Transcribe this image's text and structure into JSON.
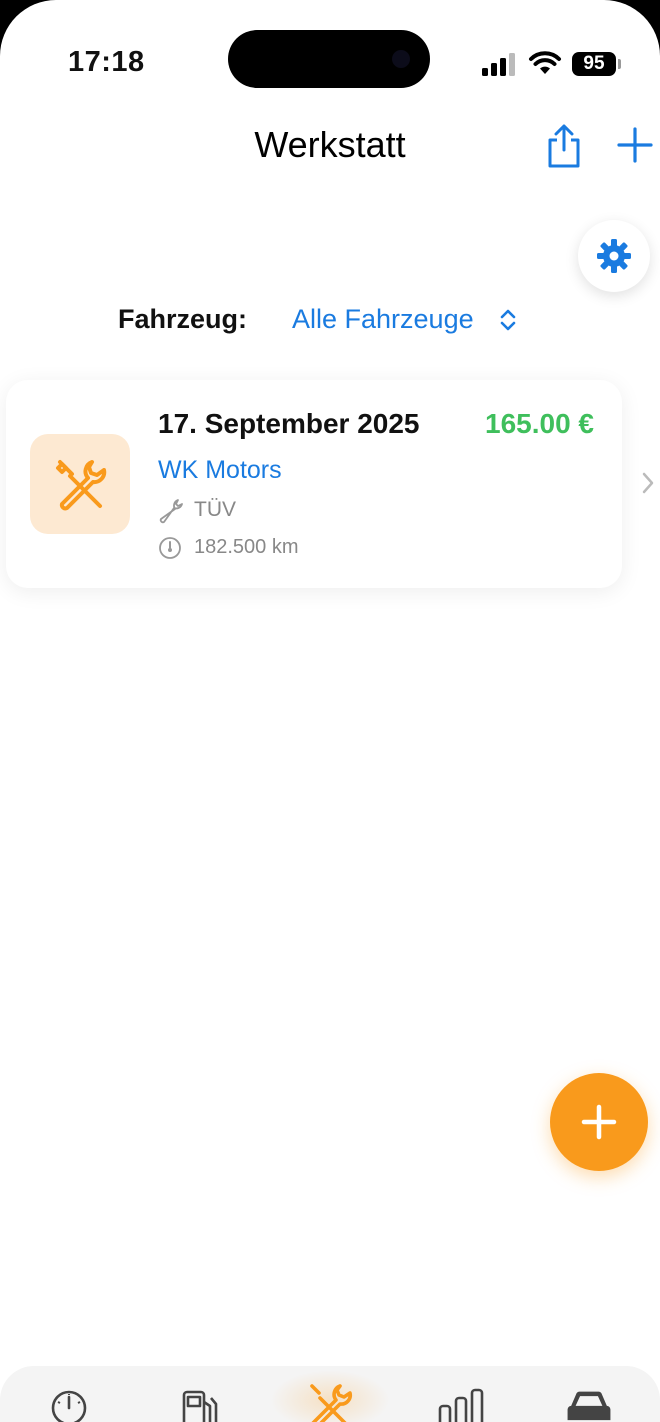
{
  "status_bar": {
    "time": "17:18",
    "battery": "95"
  },
  "nav": {
    "title": "Werkstatt"
  },
  "filter": {
    "label": "Fahrzeug:",
    "selected": "Alle Fahrzeuge"
  },
  "entries": [
    {
      "date": "17. September 2025",
      "price": "165.00 €",
      "garage": "WK Motors",
      "service": "TÜV",
      "mileage": "182.500 km"
    }
  ],
  "colors": {
    "accent_blue": "#1a7be0",
    "accent_orange": "#f99a1c",
    "price_green": "#3fbf5c"
  },
  "tabs": [
    {
      "icon": "speedometer-icon",
      "active": false
    },
    {
      "icon": "fuel-pump-icon",
      "active": false
    },
    {
      "icon": "tools-icon",
      "active": true
    },
    {
      "icon": "bar-chart-icon",
      "active": false
    },
    {
      "icon": "car-icon",
      "active": false
    }
  ]
}
